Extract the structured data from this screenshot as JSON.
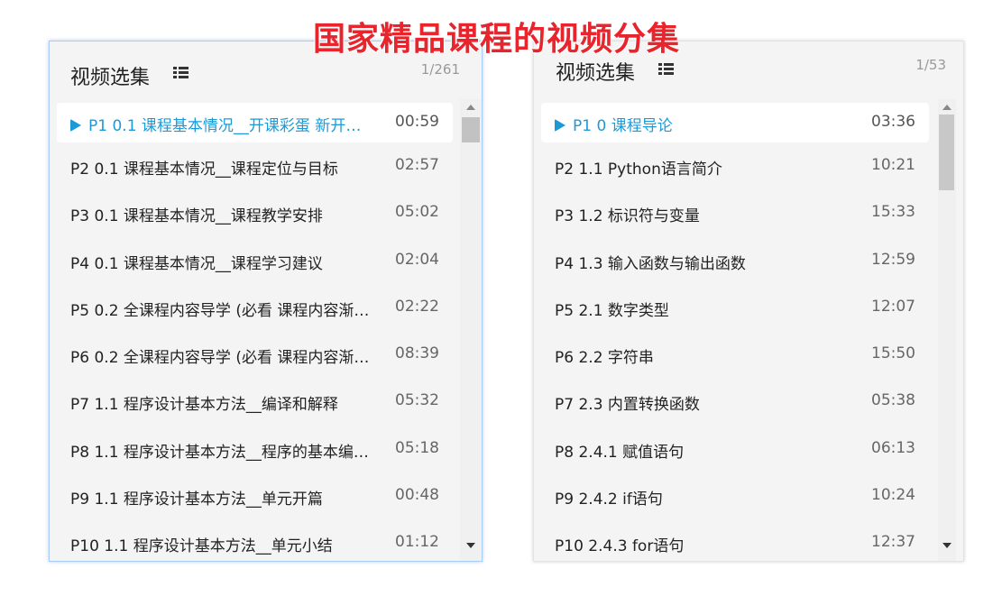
{
  "banner": {
    "title": "国家精品课程的视频分集"
  },
  "left_panel": {
    "title": "视频选集",
    "page_count": "1/261",
    "items": [
      {
        "text": "P1   0.1 课程基本情况__开课彩蛋 新开…",
        "duration": "00:59",
        "active": true
      },
      {
        "text": "P2   0.1 课程基本情况__课程定位与目标",
        "duration": "02:57"
      },
      {
        "text": "P3   0.1 课程基本情况__课程教学安排",
        "duration": "05:02"
      },
      {
        "text": "P4   0.1 课程基本情况__课程学习建议",
        "duration": "02:04"
      },
      {
        "text": "P5   0.2 全课程内容导学 (必看 课程内容渐…",
        "duration": "02:22"
      },
      {
        "text": "P6   0.2 全课程内容导学 (必看 课程内容渐…",
        "duration": "08:39"
      },
      {
        "text": "P7   1.1 程序设计基本方法__编译和解释",
        "duration": "05:32"
      },
      {
        "text": "P8   1.1 程序设计基本方法__程序的基本编…",
        "duration": "05:18"
      },
      {
        "text": "P9   1.1 程序设计基本方法__单元开篇",
        "duration": "00:48"
      },
      {
        "text": "P10   1.1 程序设计基本方法__单元小结",
        "duration": "01:12"
      }
    ]
  },
  "right_panel": {
    "title": "视频选集",
    "page_count": "1/53",
    "items": [
      {
        "text": "P1   0 课程导论",
        "duration": "03:36",
        "active": true
      },
      {
        "text": "P2   1.1 Python语言简介",
        "duration": "10:21"
      },
      {
        "text": "P3   1.2 标识符与变量",
        "duration": "15:33"
      },
      {
        "text": "P4   1.3 输入函数与输出函数",
        "duration": "12:59"
      },
      {
        "text": "P5   2.1 数字类型",
        "duration": "12:07"
      },
      {
        "text": "P6   2.2 字符串",
        "duration": "15:50"
      },
      {
        "text": "P7   2.3 内置转换函数",
        "duration": "05:38"
      },
      {
        "text": "P8   2.4.1 赋值语句",
        "duration": "06:13"
      },
      {
        "text": "P9   2.4.2 if语句",
        "duration": "10:24"
      },
      {
        "text": "P10   2.4.3 for语句",
        "duration": "12:37"
      }
    ]
  },
  "icons": {
    "list": "list-icon",
    "play": "play-icon",
    "scroll_up": "chevron-up-icon",
    "scroll_down": "chevron-down-icon"
  },
  "colors": {
    "accent": "#1c9ad8",
    "banner": "#e8242d",
    "panel_bg": "#f4f4f4"
  }
}
